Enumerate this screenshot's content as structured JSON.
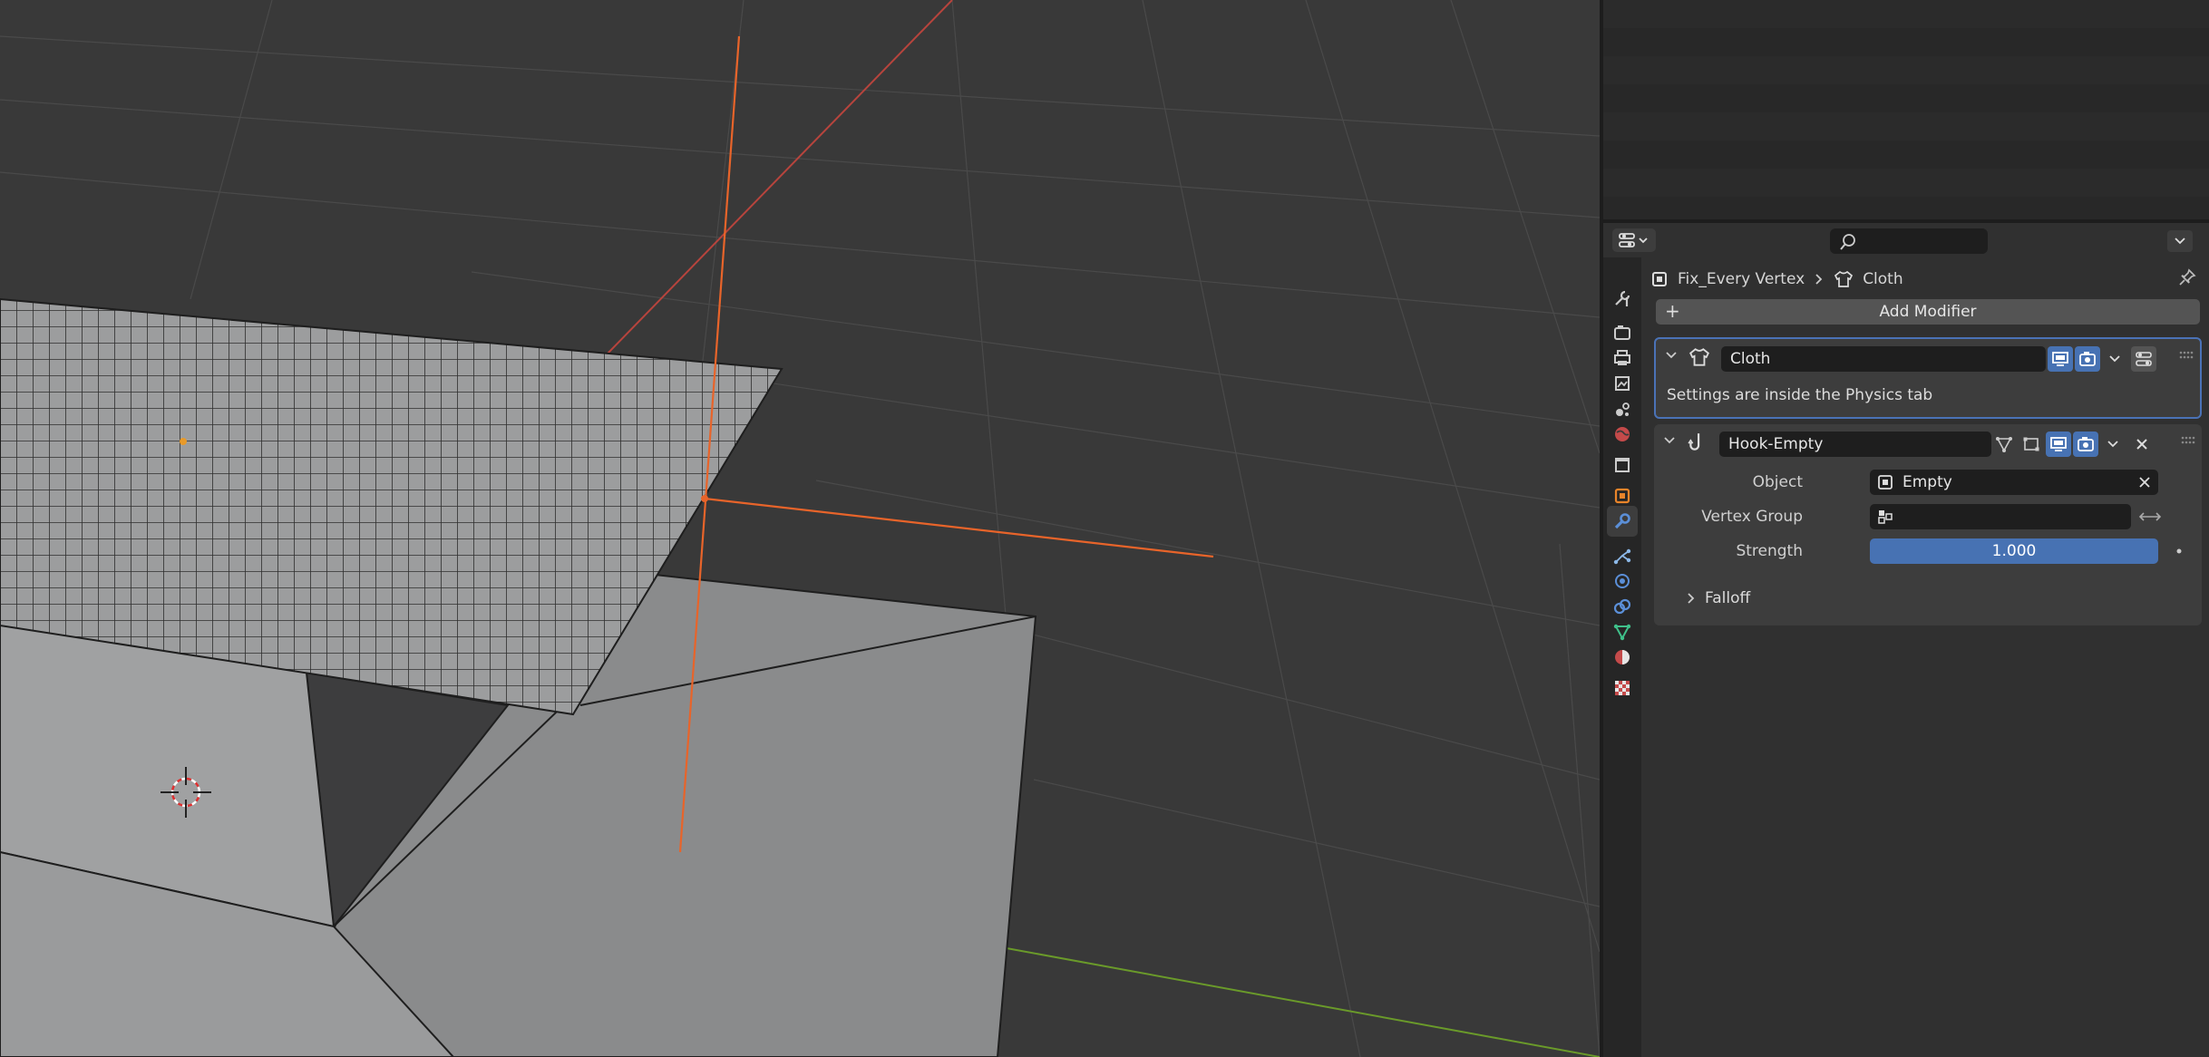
{
  "breadcrumb": {
    "object_name": "Fix_Every Vertex",
    "modifier_name": "Cloth"
  },
  "add_modifier_label": "Add Modifier",
  "modifiers": {
    "cloth": {
      "name": "Cloth",
      "info": "Settings are inside the Physics tab"
    },
    "hook": {
      "name": "Hook-Empty",
      "object_label": "Object",
      "object_value": "Empty",
      "vertex_group_label": "Vertex Group",
      "vertex_group_value": "",
      "strength_label": "Strength",
      "strength_value": "1.000",
      "falloff_label": "Falloff"
    }
  },
  "tabs": [
    "tool",
    "render",
    "output",
    "view-layer",
    "scene",
    "world",
    "collection",
    "object",
    "modifiers",
    "particles",
    "physics",
    "constraints",
    "data",
    "material",
    "texture"
  ],
  "active_tab": "modifiers",
  "colors": {
    "accent": "#4772b3",
    "selection_outline": "#4a72b6",
    "viewport_bg": "#393939",
    "empty_axes": "#e8642a",
    "x_axis": "#b7443d",
    "y_axis": "#6a9a2a"
  }
}
